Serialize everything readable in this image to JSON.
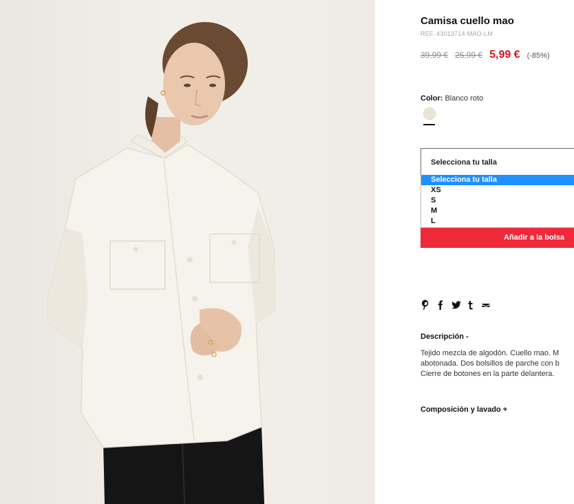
{
  "product": {
    "title": "Camisa cuello mao",
    "ref": "REF. 43013714-MAO-LM",
    "prices": {
      "original": "39,99 €",
      "previous": "25,99 €",
      "current": "5,99 €",
      "discount": "(-85%)"
    },
    "color": {
      "label": "Color:",
      "value": "Blanco roto",
      "swatch_hex": "#ece6d6"
    }
  },
  "size_select": {
    "value": "Selecciona tu talla",
    "options": [
      "Selecciona tu talla",
      "XS",
      "S",
      "M",
      "L"
    ],
    "highlighted_index": 0
  },
  "add_to_bag": {
    "label": "Añadir a la bolsa"
  },
  "share_icons": [
    "pinterest-icon",
    "facebook-icon",
    "twitter-icon",
    "tumblr-icon",
    "email-icon"
  ],
  "description": {
    "heading": "Descripción -",
    "lines": [
      "Tejido mezcla de algodón. Cuello mao. M",
      "abotonada. Dos bolsillos de parche con b",
      "Cierre de botones en la parte delantera."
    ]
  },
  "composition": {
    "heading": "Composición y lavado +"
  },
  "colors": {
    "sale_red": "#d4161f",
    "button_red": "#f0293a",
    "option_highlight": "#1e90ff"
  }
}
